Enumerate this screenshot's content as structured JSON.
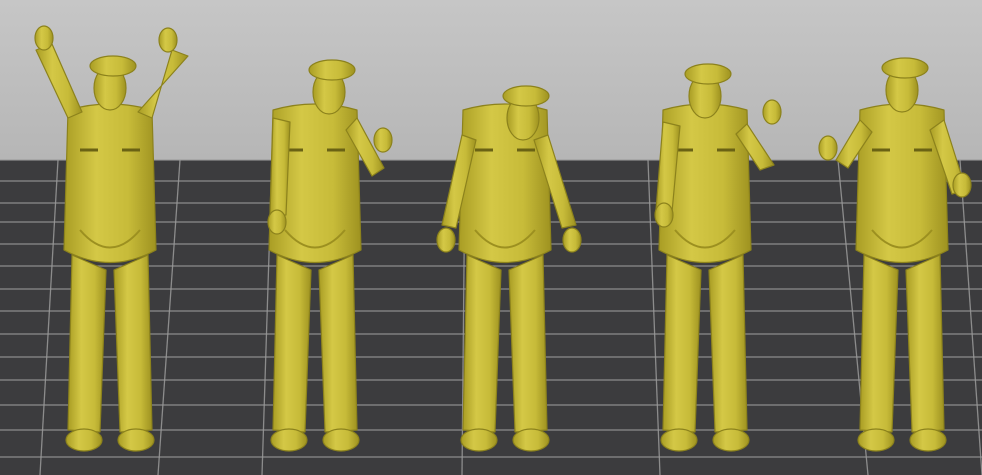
{
  "viewport": {
    "background_top": "#c4c4c4",
    "floor_color": "#3c3c3e",
    "grid_color": "#9a9a9a"
  },
  "model_color": "#c9bd3a",
  "models": [
    {
      "pose": "arms-raised"
    },
    {
      "pose": "looking-side-hand-raised"
    },
    {
      "pose": "bending-arms-down"
    },
    {
      "pose": "hand-raised-wave"
    },
    {
      "pose": "arms-out-gesture"
    }
  ]
}
